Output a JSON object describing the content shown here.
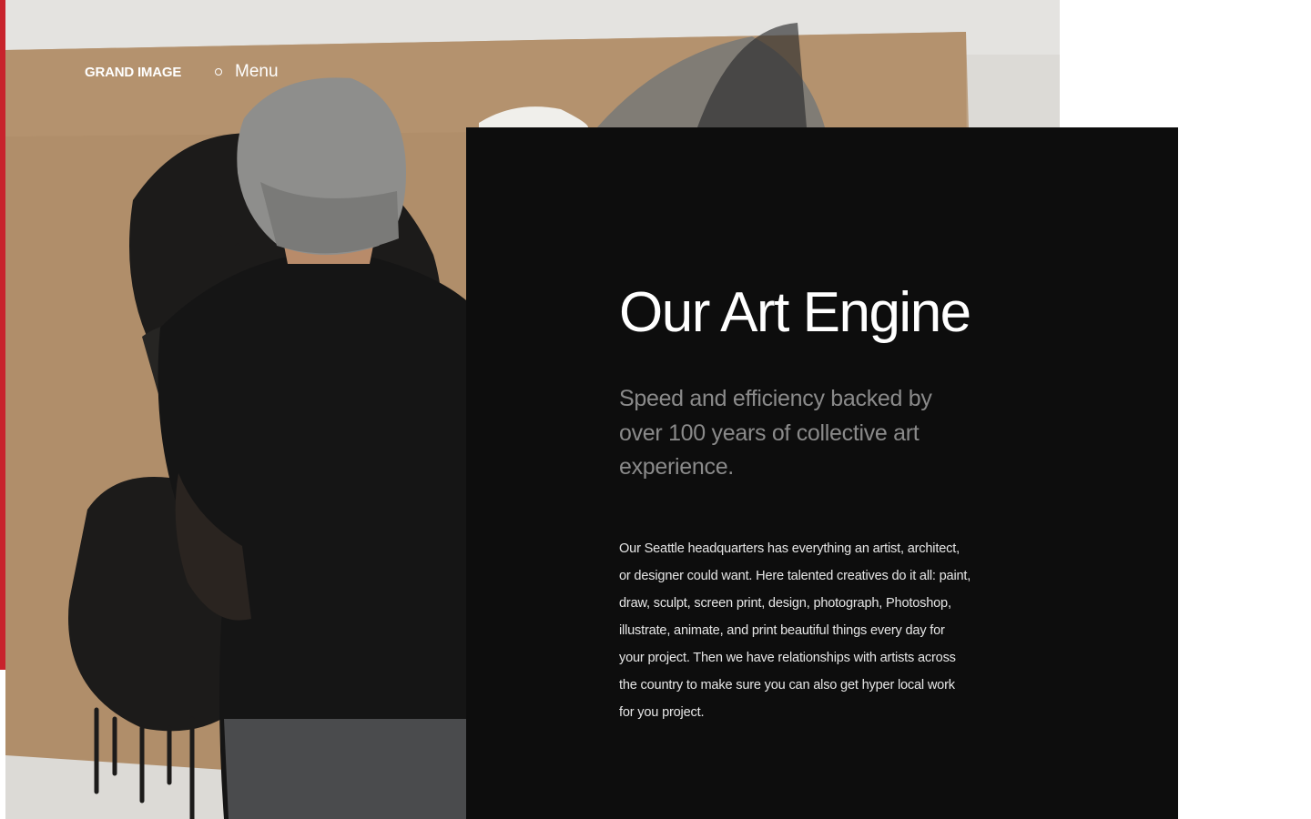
{
  "header": {
    "brand": "GRAND IMAGE",
    "menu_label": "Menu"
  },
  "hero": {
    "image_description_icon": "artist-painting-photo"
  },
  "content": {
    "title": "Our Art Engine",
    "lead": "Speed and efficiency backed by over 100 years of collective art experience.",
    "body": "Our Seattle headquarters has everything an artist, architect, or designer could want. Here talented creatives do it all: paint, draw, sculpt, screen print, design, photograph, Photoshop, illustrate, animate, and print beautiful things every day for your project. Then we have relationships with artists across the country to make sure you can also get hyper local work for you project."
  },
  "colors": {
    "accent": "#c8232c",
    "panel_bg": "#0d0d0d",
    "lead_text": "#8a8a8a",
    "body_text": "#e6e6e6"
  }
}
